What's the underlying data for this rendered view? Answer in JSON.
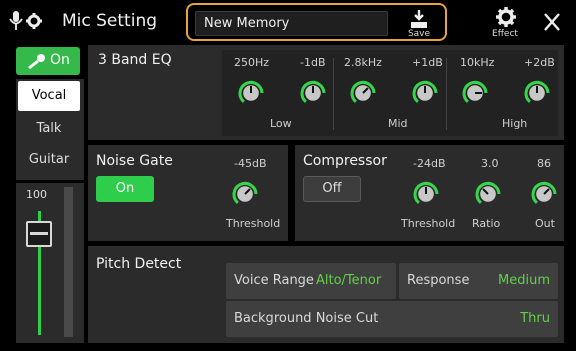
{
  "header": {
    "title": "Mic Setting",
    "memory_name": "New Memory",
    "save_label": "Save",
    "effect_label": "Effect"
  },
  "mic": {
    "on_label": "On",
    "modes": [
      "Vocal",
      "Talk",
      "Guitar"
    ],
    "selected_mode": "Vocal",
    "level": "100",
    "level_fraction": 0.9
  },
  "eq": {
    "title": "3 Band EQ",
    "bands": [
      {
        "name": "Low",
        "freq": "250Hz",
        "gain": "-1dB"
      },
      {
        "name": "Mid",
        "freq": "2.8kHz",
        "gain": "+1dB"
      },
      {
        "name": "High",
        "freq": "10kHz",
        "gain": "+2dB"
      }
    ]
  },
  "noise_gate": {
    "title": "Noise Gate",
    "state": "On",
    "threshold_value": "-45dB",
    "threshold_label": "Threshold"
  },
  "compressor": {
    "title": "Compressor",
    "state": "Off",
    "params": [
      {
        "label": "Threshold",
        "value": "-24dB"
      },
      {
        "label": "Ratio",
        "value": "3.0"
      },
      {
        "label": "Out",
        "value": "86"
      }
    ]
  },
  "pitch_detect": {
    "title": "Pitch Detect",
    "voice_range_label": "Voice Range",
    "voice_range_value": "Alto/Tenor",
    "response_label": "Response",
    "response_value": "Medium",
    "noise_cut_label": "Background Noise Cut",
    "noise_cut_value": "Thru"
  },
  "colors": {
    "accent_green": "#35b94a",
    "value_green": "#62d04a",
    "memory_border": "#e8a33a",
    "panel_bg": "#2b2b2b"
  }
}
